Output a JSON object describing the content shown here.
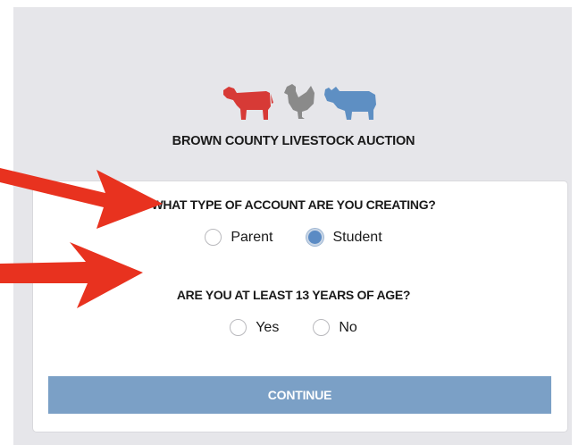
{
  "header": {
    "title": "BROWN COUNTY LIVESTOCK AUCTION",
    "logo_icons": [
      "cow-icon",
      "chicken-icon",
      "pig-icon"
    ]
  },
  "form": {
    "question_account_type": "WHAT TYPE OF ACCOUNT ARE YOU CREATING?",
    "account_options": [
      {
        "label": "Parent",
        "selected": false
      },
      {
        "label": "Student",
        "selected": true
      }
    ],
    "question_age": "ARE YOU AT LEAST 13 YEARS OF AGE?",
    "age_options": [
      {
        "label": "Yes",
        "selected": false
      },
      {
        "label": "No",
        "selected": false
      }
    ],
    "continue_label": "CONTINUE"
  },
  "colors": {
    "cow": "#d73a36",
    "chicken": "#8a8a8a",
    "pig": "#5e8fc3",
    "selected_radio": "#5b8bc4",
    "continue_button": "#7ba0c6",
    "annotation_arrow": "#e8321f",
    "panel_background": "#e6e6ea"
  }
}
